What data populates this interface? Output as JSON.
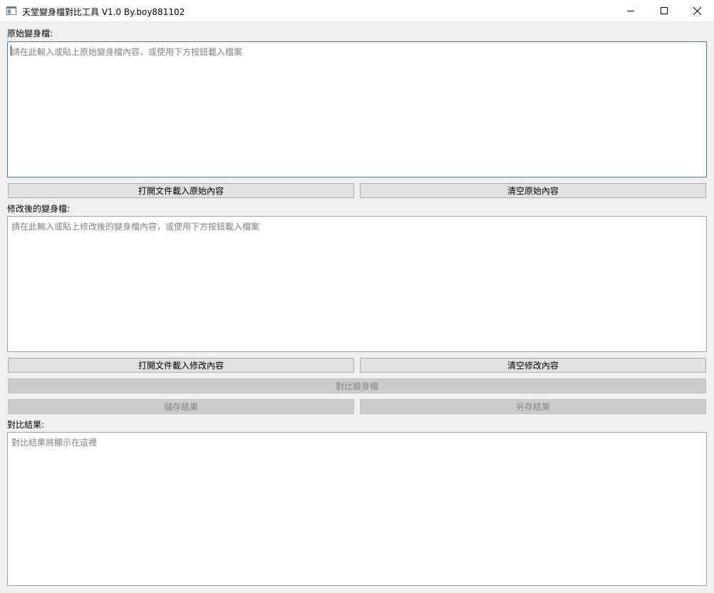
{
  "window": {
    "title": "天堂變身檔對比工具 V1.0 By.boy881102",
    "icon": "app-window-icon"
  },
  "original": {
    "label": "原始變身檔:",
    "placeholder": "請在此輸入或貼上原始變身檔內容，或使用下方按鈕載入檔案",
    "open_button": "打開文件載入原始內容",
    "clear_button": "清空原始內容"
  },
  "modified": {
    "label": "修改後的變身檔:",
    "placeholder": "請在此輸入或貼上修改後的變身檔內容，或使用下方按鈕載入檔案",
    "open_button": "打開文件載入修改內容",
    "clear_button": "清空修改內容"
  },
  "actions": {
    "compare_button": "對比變身檔",
    "save_button": "儲存結果",
    "save_as_button": "另存結果"
  },
  "result": {
    "label": "對比結果:",
    "placeholder": "對比結果將顯示在這裡"
  },
  "colors": {
    "focus_border": "#3c7fb1",
    "disabled_text": "#838383"
  }
}
